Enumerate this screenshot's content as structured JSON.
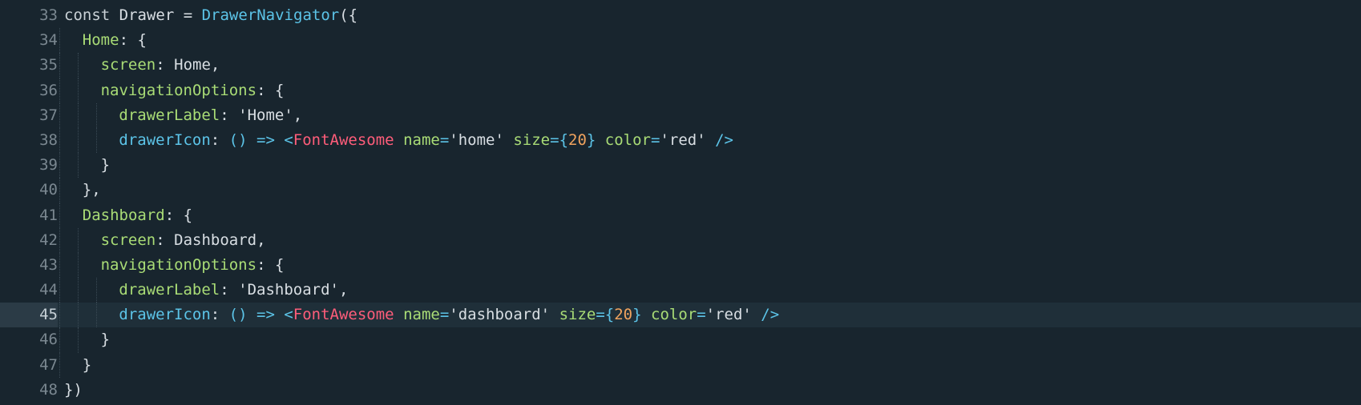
{
  "editor": {
    "active_line": "45",
    "lines": [
      {
        "num": "33",
        "indent": 0,
        "tokens": [
          {
            "t": "const ",
            "c": "kw"
          },
          {
            "t": "Drawer ",
            "c": "plain"
          },
          {
            "t": "= ",
            "c": "plain"
          },
          {
            "t": "DrawerNavigator",
            "c": "fn"
          },
          {
            "t": "({",
            "c": "plain"
          }
        ]
      },
      {
        "num": "34",
        "indent": 1,
        "tokens": [
          {
            "t": "Home",
            "c": "key"
          },
          {
            "t": ": {",
            "c": "plain"
          }
        ]
      },
      {
        "num": "35",
        "indent": 2,
        "tokens": [
          {
            "t": "screen",
            "c": "key"
          },
          {
            "t": ": ",
            "c": "plain"
          },
          {
            "t": "Home",
            "c": "plain"
          },
          {
            "t": ",",
            "c": "plain"
          }
        ]
      },
      {
        "num": "36",
        "indent": 2,
        "tokens": [
          {
            "t": "navigationOptions",
            "c": "key"
          },
          {
            "t": ": {",
            "c": "plain"
          }
        ]
      },
      {
        "num": "37",
        "indent": 3,
        "tokens": [
          {
            "t": "drawerLabel",
            "c": "key"
          },
          {
            "t": ": ",
            "c": "plain"
          },
          {
            "t": "'Home'",
            "c": "str"
          },
          {
            "t": ",",
            "c": "plain"
          }
        ]
      },
      {
        "num": "38",
        "indent": 3,
        "tokens": [
          {
            "t": "drawerIcon",
            "c": "fn"
          },
          {
            "t": ": ",
            "c": "plain"
          },
          {
            "t": "() ",
            "c": "punc"
          },
          {
            "t": "=> ",
            "c": "arrow"
          },
          {
            "t": "<",
            "c": "punc"
          },
          {
            "t": "FontAwesome ",
            "c": "tag"
          },
          {
            "t": "name",
            "c": "attr"
          },
          {
            "t": "=",
            "c": "punc"
          },
          {
            "t": "'home' ",
            "c": "str"
          },
          {
            "t": "size",
            "c": "attr"
          },
          {
            "t": "={",
            "c": "punc"
          },
          {
            "t": "20",
            "c": "num"
          },
          {
            "t": "} ",
            "c": "punc"
          },
          {
            "t": "color",
            "c": "attr"
          },
          {
            "t": "=",
            "c": "punc"
          },
          {
            "t": "'red' ",
            "c": "str"
          },
          {
            "t": "/>",
            "c": "punc"
          }
        ]
      },
      {
        "num": "39",
        "indent": 2,
        "tokens": [
          {
            "t": "}",
            "c": "plain"
          }
        ]
      },
      {
        "num": "40",
        "indent": 1,
        "tokens": [
          {
            "t": "},",
            "c": "plain"
          }
        ]
      },
      {
        "num": "41",
        "indent": 1,
        "tokens": [
          {
            "t": "Dashboard",
            "c": "key"
          },
          {
            "t": ": {",
            "c": "plain"
          }
        ]
      },
      {
        "num": "42",
        "indent": 2,
        "tokens": [
          {
            "t": "screen",
            "c": "key"
          },
          {
            "t": ": ",
            "c": "plain"
          },
          {
            "t": "Dashboard",
            "c": "plain"
          },
          {
            "t": ",",
            "c": "plain"
          }
        ]
      },
      {
        "num": "43",
        "indent": 2,
        "tokens": [
          {
            "t": "navigationOptions",
            "c": "key"
          },
          {
            "t": ": {",
            "c": "plain"
          }
        ]
      },
      {
        "num": "44",
        "indent": 3,
        "tokens": [
          {
            "t": "drawerLabel",
            "c": "key"
          },
          {
            "t": ": ",
            "c": "plain"
          },
          {
            "t": "'Dashboard'",
            "c": "str"
          },
          {
            "t": ",",
            "c": "plain"
          }
        ]
      },
      {
        "num": "45",
        "indent": 3,
        "tokens": [
          {
            "t": "drawerIcon",
            "c": "fn"
          },
          {
            "t": ": ",
            "c": "plain"
          },
          {
            "t": "() ",
            "c": "punc"
          },
          {
            "t": "=> ",
            "c": "arrow"
          },
          {
            "t": "<",
            "c": "punc"
          },
          {
            "t": "FontAwesome ",
            "c": "tag"
          },
          {
            "t": "name",
            "c": "attr"
          },
          {
            "t": "=",
            "c": "punc"
          },
          {
            "t": "'dashboard' ",
            "c": "str"
          },
          {
            "t": "size",
            "c": "attr"
          },
          {
            "t": "={",
            "c": "punc"
          },
          {
            "t": "20",
            "c": "num"
          },
          {
            "t": "} ",
            "c": "punc"
          },
          {
            "t": "color",
            "c": "attr"
          },
          {
            "t": "=",
            "c": "punc"
          },
          {
            "t": "'red' ",
            "c": "str"
          },
          {
            "t": "/>",
            "c": "punc"
          }
        ]
      },
      {
        "num": "46",
        "indent": 2,
        "tokens": [
          {
            "t": "}",
            "c": "plain"
          }
        ]
      },
      {
        "num": "47",
        "indent": 1,
        "tokens": [
          {
            "t": "}",
            "c": "plain"
          }
        ]
      },
      {
        "num": "48",
        "indent": 0,
        "tokens": [
          {
            "t": "})",
            "c": "plain"
          }
        ]
      }
    ]
  },
  "colors": {
    "background": "#18252e",
    "active_line": "#1f2f39",
    "key": "#a9dc76",
    "function": "#5cc4e8",
    "tag": "#ff5d7a",
    "number": "#f0a35e"
  }
}
